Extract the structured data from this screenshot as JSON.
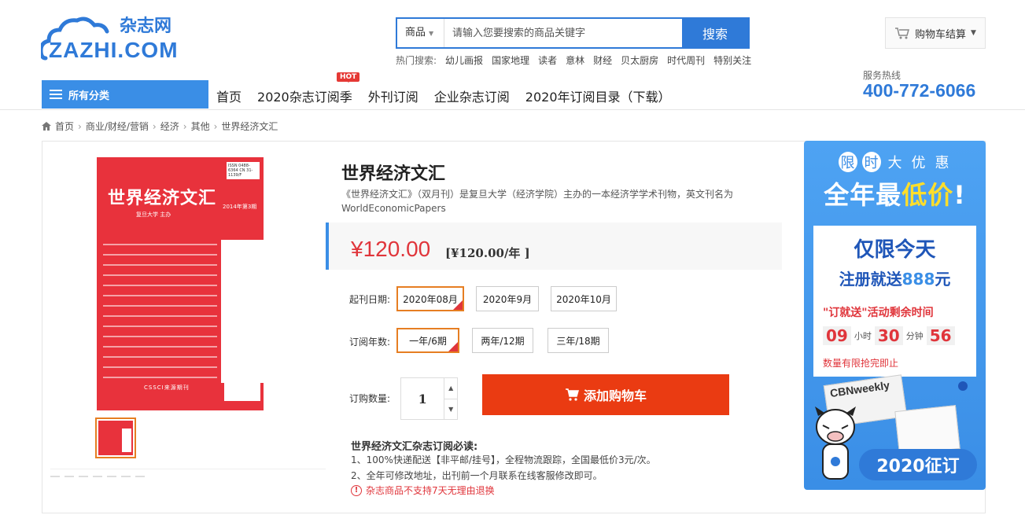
{
  "logo": {
    "cn": "杂志网",
    "en": "ZAZHI.COM"
  },
  "search": {
    "category": "商品",
    "placeholder": "请输入您要搜索的商品关键字",
    "button": "搜索",
    "hot_label": "热门搜索:",
    "hot_keywords": [
      "幼儿画报",
      "国家地理",
      "读者",
      "意林",
      "财经",
      "贝太厨房",
      "时代周刊",
      "特别关注"
    ]
  },
  "cart": {
    "label": "购物车结算"
  },
  "nav": {
    "all_categories": "所有分类",
    "links": [
      "首页",
      "2020杂志订阅季",
      "外刊订阅",
      "企业杂志订阅",
      "2020年订阅目录（下载）"
    ],
    "hot_tag": "HOT"
  },
  "hotline": {
    "label": "服务热线",
    "number": "400-772-6066"
  },
  "breadcrumb": [
    "首页",
    "商业/财经/营销",
    "经济",
    "其他",
    "世界经济文汇"
  ],
  "cover": {
    "title": "世界经济文汇",
    "sub": "复旦大学 主办",
    "issue": "2014年第3期",
    "issn": "ISSN 0488-6364 CN 31-1139/F",
    "footer": "CSSCI来源期刊"
  },
  "product": {
    "title": "世界经济文汇",
    "description": "《世界经济文汇》（双月刊）是复旦大学（经济学院）主办的一本经济学学术刊物，英文刊名为WorldEconomicPapers",
    "price": "¥120.00",
    "price_per_year": "[¥120.00/年 ]",
    "start_label": "起刊日期:",
    "start_options": [
      "2020年08月",
      "2020年9月",
      "2020年10月"
    ],
    "start_selected": 0,
    "years_label": "订阅年数:",
    "year_options": [
      "一年/6期",
      "两年/12期",
      "三年/18期"
    ],
    "year_selected": 0,
    "qty_label": "订购数量:",
    "qty": "1",
    "add_cart": "添加购物车",
    "notice_title": "世界经济文汇杂志订阅必读:",
    "notice_lines": [
      "1、100%快递配送【非平邮/挂号】，全程物流跟踪，全国最低价3元/次。",
      "2、全年可修改地址，出刊前一个月联系在线客服修改即可。"
    ],
    "warning": "杂志商品不支持7天无理由退换"
  },
  "promo": {
    "top_chars": [
      "限",
      "时",
      "大",
      "优",
      "惠"
    ],
    "main_a": "全年最",
    "main_b": "低价",
    "main_c": "!",
    "line1": "仅限今天",
    "line2a": "注册就送",
    "line2b": "888",
    "line2c": "元",
    "line3": "\"订就送\"活动剩余时间",
    "hours": "09",
    "hours_unit": "小时",
    "minutes": "30",
    "minutes_unit": "分钟",
    "seconds": "56",
    "limit": "数量有限抢完即止",
    "cbn": "CBNweekly",
    "badge": "2020征订"
  },
  "colors": {
    "brand_blue": "#2f7ad8",
    "price_red": "#e0353b",
    "cart_orange": "#ea3b12",
    "select_orange": "#e67e22"
  }
}
